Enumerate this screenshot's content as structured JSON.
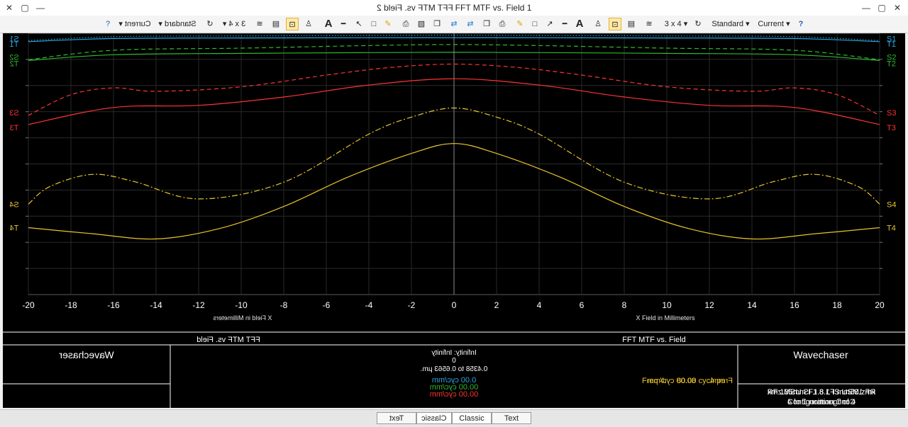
{
  "window": {
    "title_mirrored": "FFT MTF vs. Field 2",
    "title": "FFT MTF vs. Field 1"
  },
  "toolbar": {
    "standard_label": "Standard",
    "current_label": "Current",
    "layout_label": "3 x 4",
    "dropdown_mark": "▾",
    "help_icon": "help-icon"
  },
  "plot": {
    "title": "FFT MTF vs. Field",
    "company": "Wavechaser",
    "info_line1": "Infinity: Infinity",
    "info_line2": "0",
    "info_line3": "0.4358 to 0.6563 µm.",
    "freq_label": "Freq 4:",
    "freq_value": "80.00 cyc/mm",
    "legend_lines": [
      {
        "text": "0.00 cyc/mm",
        "color": "#29a7e0"
      },
      {
        "text": "00.00 cyc/mm",
        "color": "#2fb82f"
      },
      {
        "text": "00.00 cyc/mm",
        "color": "#ff3333"
      }
    ],
    "lens_file": "RF 135mm F1.8 L IS USM.zmx",
    "config": "Configuration 1 of 4",
    "bottom_tabs": [
      "Text",
      "Classic",
      "Classic",
      "Text"
    ]
  },
  "chart_data": {
    "type": "line",
    "xlabel": "X Field in Millimeters",
    "xlim": [
      -20,
      20
    ],
    "xticks": [
      -20,
      -18,
      -16,
      -14,
      -12,
      -10,
      -8,
      -6,
      -4,
      -2,
      0,
      2,
      4,
      6,
      8,
      10,
      12,
      14,
      16,
      18,
      20
    ],
    "ylim": [
      0,
      1
    ],
    "grid": true,
    "series": [
      {
        "name": "S1",
        "color": "#29a7e0",
        "style": "dotted",
        "x": [
          -20,
          -16,
          -10,
          -4,
          0,
          4,
          10,
          16,
          20
        ],
        "y": [
          0.972,
          0.987,
          0.99,
          0.992,
          0.993,
          0.992,
          0.99,
          0.987,
          0.972
        ]
      },
      {
        "name": "T1",
        "color": "#29a7e0",
        "style": "solid",
        "x": [
          -20,
          -16,
          -10,
          -4,
          0,
          4,
          10,
          16,
          20
        ],
        "y": [
          0.968,
          0.98,
          0.982,
          0.983,
          0.983,
          0.983,
          0.982,
          0.98,
          0.968
        ]
      },
      {
        "name": "S2",
        "color": "#2fb82f",
        "style": "dashed",
        "x": [
          -20,
          -16,
          -10,
          -4,
          0,
          4,
          10,
          16,
          20
        ],
        "y": [
          0.899,
          0.935,
          0.943,
          0.953,
          0.957,
          0.953,
          0.943,
          0.935,
          0.899
        ]
      },
      {
        "name": "T2",
        "color": "#2fb82f",
        "style": "solid",
        "x": [
          -20,
          -16,
          -10,
          -4,
          0,
          4,
          10,
          16,
          20
        ],
        "y": [
          0.896,
          0.918,
          0.923,
          0.926,
          0.927,
          0.926,
          0.923,
          0.918,
          0.896
        ]
      },
      {
        "name": "S3",
        "color": "#ff3333",
        "style": "dashed",
        "x": [
          -20,
          -18,
          -16,
          -14,
          -10,
          -6,
          -3,
          0,
          3,
          6,
          10,
          14,
          16,
          18,
          20
        ],
        "y": [
          0.686,
          0.765,
          0.791,
          0.778,
          0.795,
          0.84,
          0.869,
          0.882,
          0.869,
          0.84,
          0.795,
          0.778,
          0.791,
          0.765,
          0.686
        ]
      },
      {
        "name": "T3",
        "color": "#ff3333",
        "style": "solid",
        "x": [
          -20,
          -16,
          -12,
          -8,
          -4,
          0,
          4,
          8,
          12,
          16,
          20
        ],
        "y": [
          0.651,
          0.716,
          0.724,
          0.756,
          0.802,
          0.826,
          0.802,
          0.756,
          0.724,
          0.716,
          0.651
        ]
      },
      {
        "name": "S4",
        "color": "#e8c42c",
        "style": "dashdot",
        "x": [
          -20,
          -19,
          -17,
          -15,
          -12,
          -8,
          -4,
          -2,
          0,
          2,
          4,
          8,
          12,
          15,
          17,
          19,
          20
        ],
        "y": [
          0.346,
          0.413,
          0.46,
          0.432,
          0.366,
          0.43,
          0.614,
          0.679,
          0.714,
          0.679,
          0.614,
          0.43,
          0.366,
          0.432,
          0.46,
          0.413,
          0.346
        ]
      },
      {
        "name": "T4",
        "color": "#e8c42c",
        "style": "solid",
        "x": [
          -20,
          -17,
          -14,
          -11,
          -8,
          -5,
          -2,
          0,
          2,
          5,
          8,
          11,
          14,
          17,
          20
        ],
        "y": [
          0.256,
          0.233,
          0.213,
          0.253,
          0.337,
          0.449,
          0.54,
          0.578,
          0.54,
          0.449,
          0.337,
          0.253,
          0.213,
          0.233,
          0.256
        ]
      }
    ]
  }
}
